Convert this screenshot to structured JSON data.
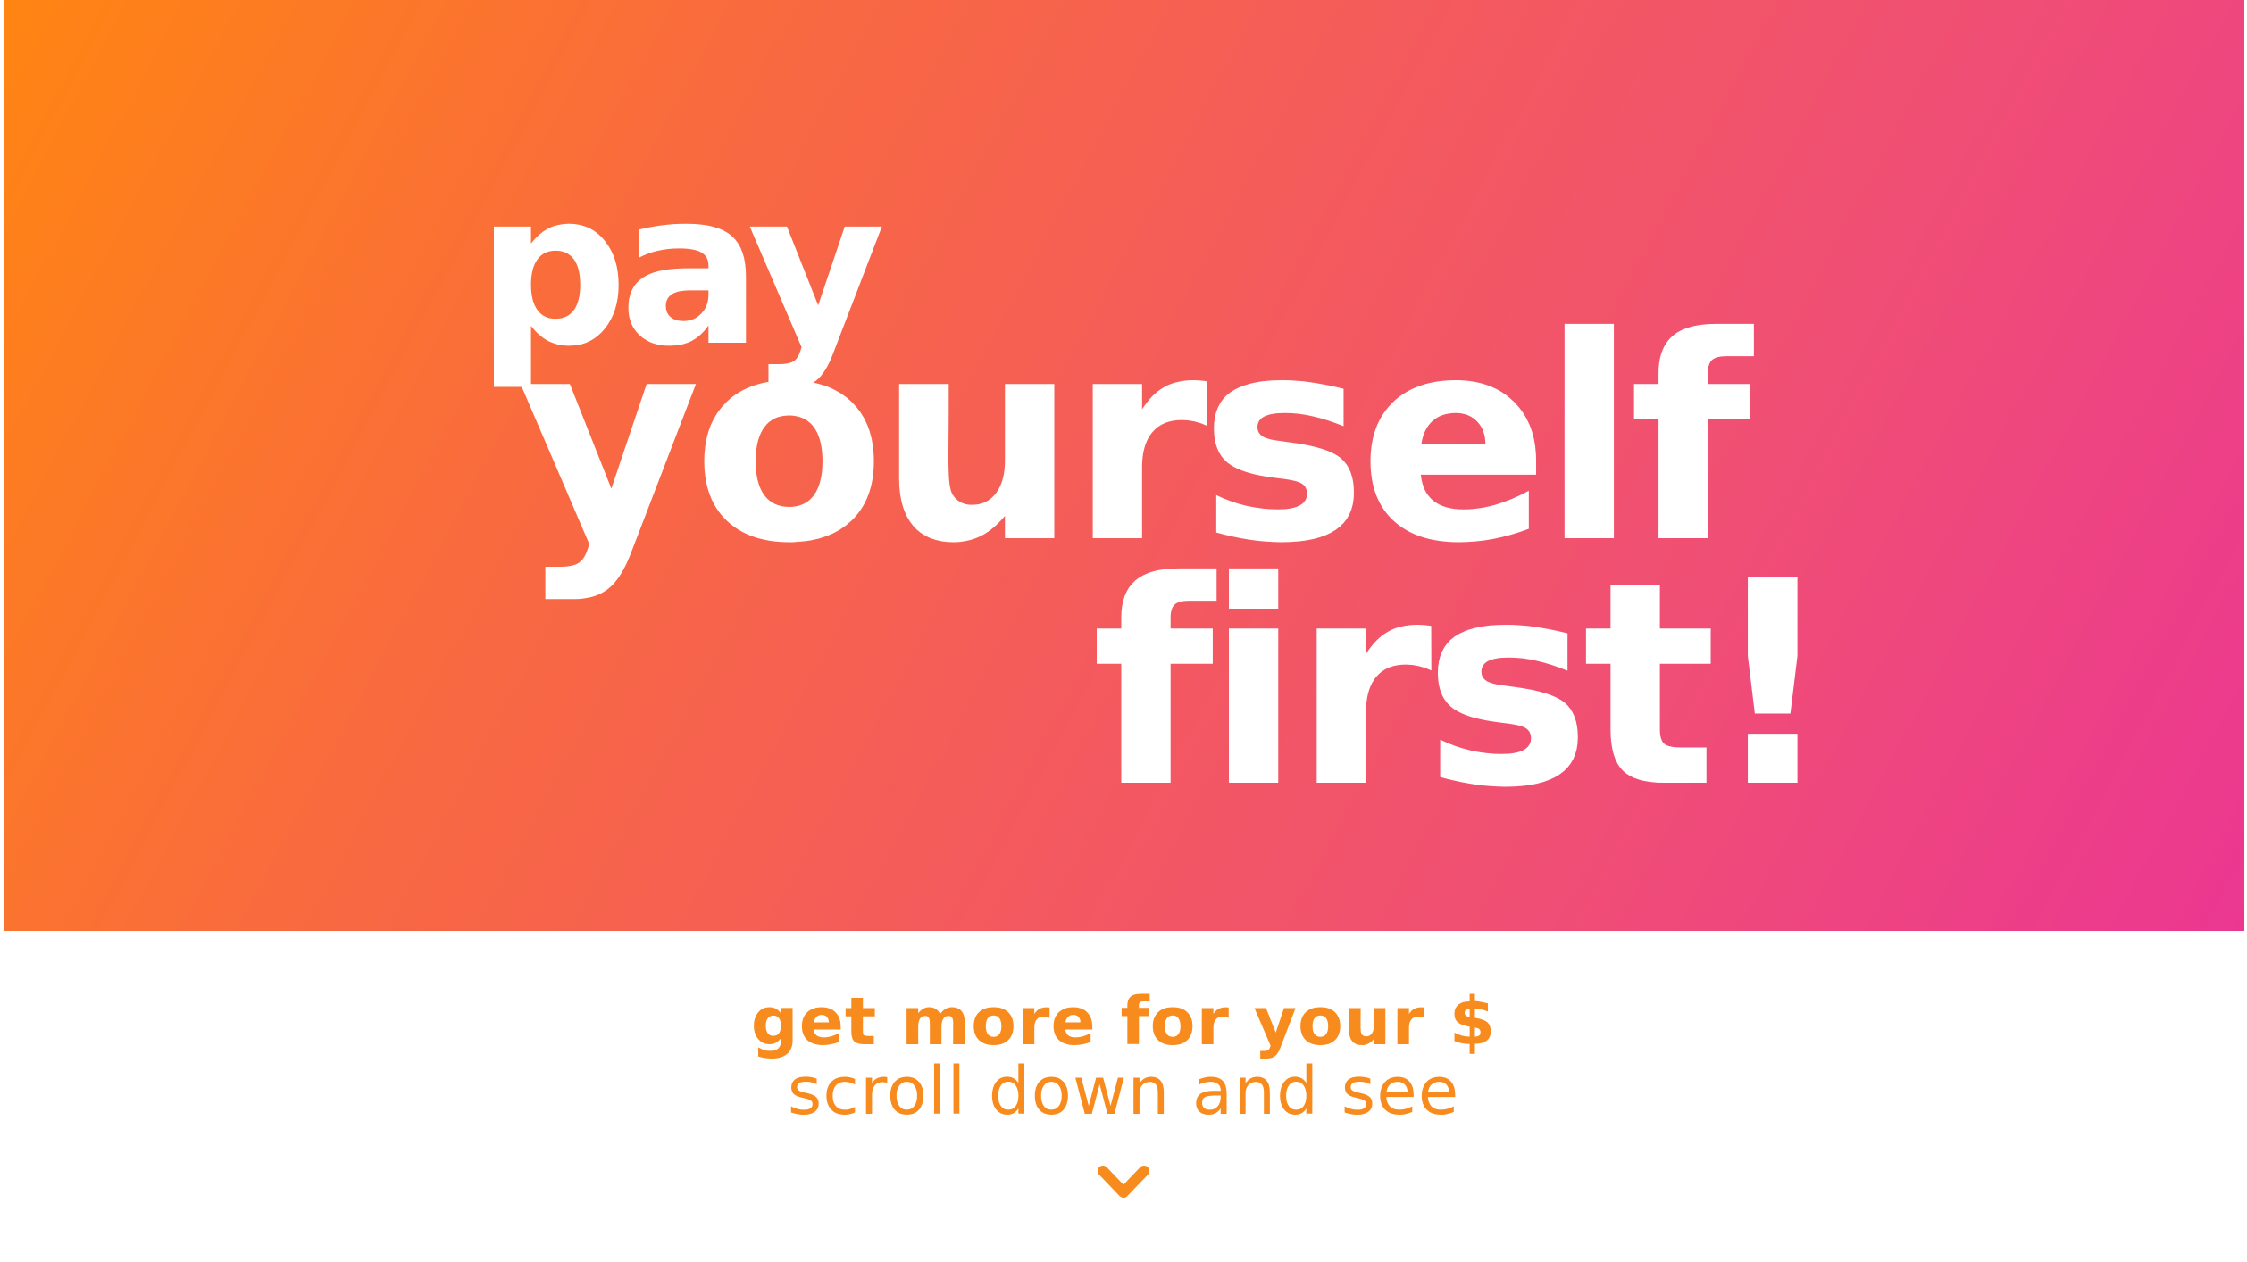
{
  "hero": {
    "line_1": "pay",
    "line_2": "yourself",
    "line_3": "first!"
  },
  "tagline": {
    "strong": "get more for your $",
    "light": "scroll down and see"
  },
  "scroll_indicator": {
    "icon": "chevron-down-icon"
  },
  "colors": {
    "gradient_start": "#ff8512",
    "gradient_end": "#eb3791",
    "text_accent": "#f88b1d",
    "hero_text": "#ffffff"
  }
}
